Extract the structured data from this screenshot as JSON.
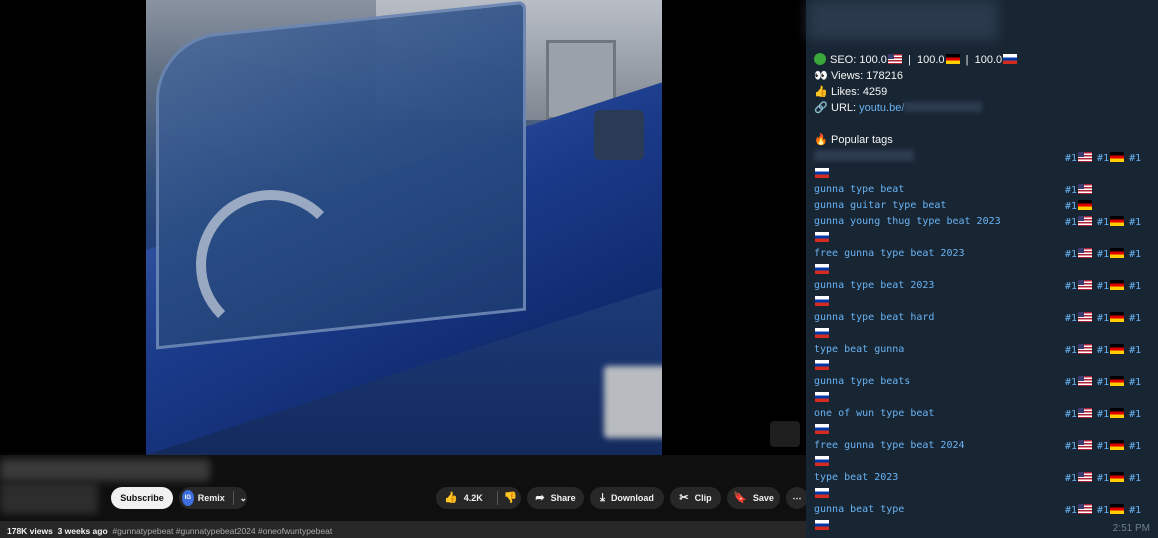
{
  "youtube": {
    "buttons": {
      "subscribe": "Subscribe",
      "remix_badge": "IG",
      "remix": "Remix",
      "likes": "4.2K",
      "share": "Share",
      "download": "Download",
      "clip": "Clip",
      "save": "Save",
      "more": "⋯"
    },
    "meta": {
      "views": "178K views",
      "age": "3 weeks ago",
      "hashtags": "#gunnatypebeat #gunnatypebeat2024 #oneofwuntypebeat"
    }
  },
  "telegram": {
    "stats": {
      "seo_label": "SEO:",
      "seo_us": "100.0",
      "seo_de": "100.0",
      "seo_ru": "100.0",
      "sep": "|",
      "views_label": "Views:",
      "views": "178216",
      "likes_label": "Likes:",
      "likes": "4259",
      "url_label": "URL:",
      "url": "youtu.be/"
    },
    "popular_tags_label": "Popular tags",
    "rank": "#1",
    "tags": [
      {
        "name": "",
        "flags": [
          "us",
          "de",
          "ru"
        ]
      },
      {
        "name": "gunna type beat",
        "flags": [
          "us"
        ]
      },
      {
        "name": "gunna guitar type beat",
        "flags": [
          "de"
        ]
      },
      {
        "name": "gunna young thug type beat 2023",
        "flags": [
          "us",
          "de",
          "ru"
        ]
      },
      {
        "name": "free gunna type beat 2023",
        "flags": [
          "us",
          "de",
          "ru"
        ]
      },
      {
        "name": "gunna type beat 2023",
        "flags": [
          "us",
          "de",
          "ru"
        ]
      },
      {
        "name": "gunna type beat hard",
        "flags": [
          "us",
          "de",
          "ru"
        ]
      },
      {
        "name": "type beat gunna",
        "flags": [
          "us",
          "de",
          "ru"
        ]
      },
      {
        "name": "gunna type beats",
        "flags": [
          "us",
          "de",
          "ru"
        ]
      },
      {
        "name": "one of wun type beat",
        "flags": [
          "us",
          "de",
          "ru"
        ]
      },
      {
        "name": "free gunna type beat 2024",
        "flags": [
          "us",
          "de",
          "ru"
        ]
      },
      {
        "name": "type beat 2023",
        "flags": [
          "us",
          "de",
          "ru"
        ]
      },
      {
        "name": "gunna beat type",
        "flags": [
          "us",
          "de",
          "ru"
        ]
      }
    ],
    "time": "2:51 PM"
  }
}
